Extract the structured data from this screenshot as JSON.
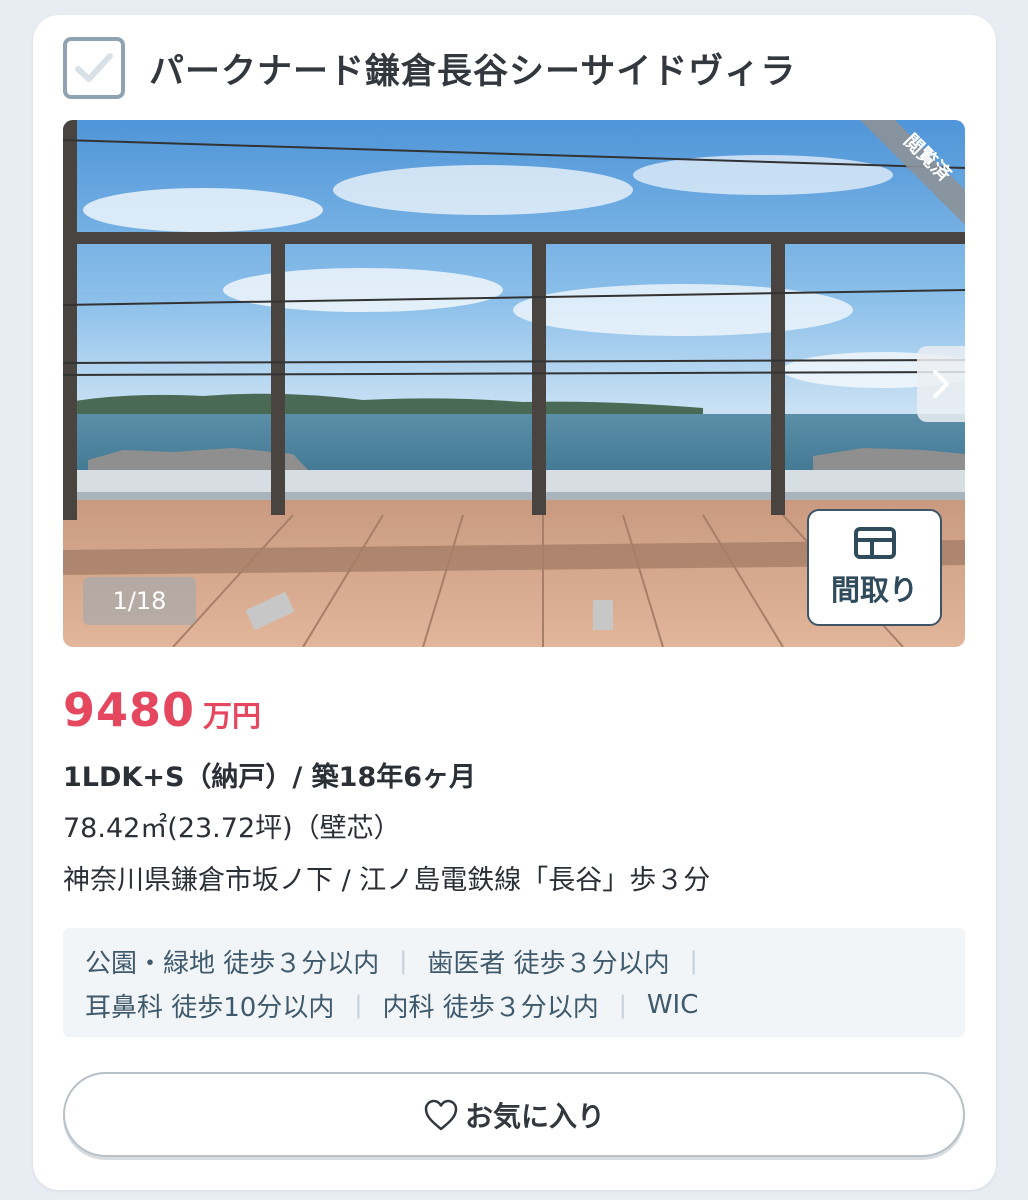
{
  "listing": {
    "title": "パークナード鎌倉長谷シーサイドヴィラ",
    "selected": true
  },
  "gallery": {
    "badge": "閲覧済",
    "counter": "1/18",
    "floorplan_button": "間取り",
    "icons": {
      "next": "chevron-right-icon",
      "floorplan": "floorplan-icon",
      "check": "check-icon"
    }
  },
  "price": {
    "amount": "9480",
    "unit": "万円"
  },
  "details": {
    "layout_age": "1LDK+S（納戸）/ 築18年6ヶ月",
    "area": "78.42㎡(23.72坪)（壁芯）",
    "location": "神奈川県鎌倉市坂ノ下 / 江ノ島電鉄線「長谷」歩３分"
  },
  "tags": [
    "公園・緑地 徒歩３分以内",
    "歯医者 徒歩３分以内",
    "耳鼻科 徒歩10分以内",
    "内科 徒歩３分以内",
    "WIC"
  ],
  "favorite": {
    "label": "お気に入り",
    "icon": "heart-icon"
  },
  "colors": {
    "price": "#e5475f",
    "tag_text": "#3f5a6d",
    "tag_bg": "#f2f5f8",
    "page_bg": "#e8edf3"
  }
}
